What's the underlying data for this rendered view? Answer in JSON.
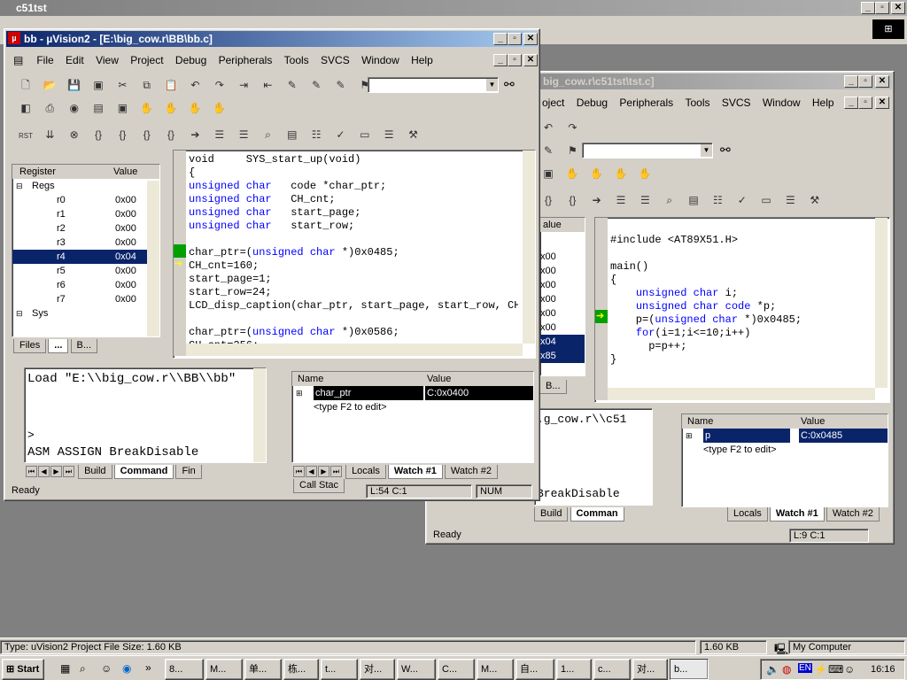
{
  "desktop_window": {
    "title": "c51tst",
    "menu_hint": "File  Edit  View  Project  Debug  Peripherals  Tools  SVCS  Window  Help"
  },
  "main_window": {
    "title": "bb - µVision2 - [E:\\big_cow.r\\BB\\bb.c]",
    "menu": [
      "File",
      "Edit",
      "View",
      "Project",
      "Debug",
      "Peripherals",
      "Tools",
      "SVCS",
      "Window",
      "Help"
    ],
    "find_box_value": "",
    "register_panel": {
      "headers": [
        "Register",
        "Value"
      ],
      "groups": [
        {
          "name": "Regs",
          "rows": [
            {
              "name": "r0",
              "value": "0x00"
            },
            {
              "name": "r1",
              "value": "0x00"
            },
            {
              "name": "r2",
              "value": "0x00"
            },
            {
              "name": "r3",
              "value": "0x00"
            },
            {
              "name": "r4",
              "value": "0x04"
            },
            {
              "name": "r5",
              "value": "0x00"
            },
            {
              "name": "r6",
              "value": "0x00"
            },
            {
              "name": "r7",
              "value": "0x00"
            }
          ]
        },
        {
          "name": "Sys",
          "rows": []
        }
      ],
      "tabs": [
        "Files",
        "...",
        "B..."
      ]
    },
    "code_lines": [
      [
        {
          "t": "void     SYS_start_up(void)",
          "k": false
        }
      ],
      [
        {
          "t": "{",
          "k": false
        }
      ],
      [
        {
          "t": "unsigned char",
          "k": true
        },
        {
          "t": "   code *char_ptr;",
          "k": false
        }
      ],
      [
        {
          "t": "unsigned char",
          "k": true
        },
        {
          "t": "   CH_cnt;",
          "k": false
        }
      ],
      [
        {
          "t": "unsigned char",
          "k": true
        },
        {
          "t": "   start_page;",
          "k": false
        }
      ],
      [
        {
          "t": "unsigned char",
          "k": true
        },
        {
          "t": "   start_row;",
          "k": false
        }
      ],
      [
        {
          "t": "",
          "k": false
        }
      ],
      [
        {
          "t": "char_ptr=(",
          "k": false
        },
        {
          "t": "unsigned char",
          "k": true
        },
        {
          "t": " *)0x0485;",
          "k": false
        }
      ],
      [
        {
          "t": "CH_cnt=160;",
          "k": false
        }
      ],
      [
        {
          "t": "start_page=1;",
          "k": false
        }
      ],
      [
        {
          "t": "start_row=24;",
          "k": false
        }
      ],
      [
        {
          "t": "LCD_disp_caption(char_ptr, start_page, start_row, CH_c",
          "k": false
        }
      ],
      [
        {
          "t": "",
          "k": false
        }
      ],
      [
        {
          "t": "char_ptr=(",
          "k": false
        },
        {
          "t": "unsigned char",
          "k": true
        },
        {
          "t": " *)0x0586;",
          "k": false
        }
      ],
      [
        {
          "t": "CH_cnt=256;",
          "k": false
        }
      ]
    ],
    "output": {
      "line1": "Load \"E:\\\\big_cow.r\\\\BB\\\\bb\"",
      "prompt": ">",
      "line2": "ASM ASSIGN BreakDisable",
      "tabs": [
        "Build",
        "Command",
        "Fin"
      ]
    },
    "watch": {
      "headers": [
        "Name",
        "Value"
      ],
      "rows": [
        {
          "name": "char_ptr",
          "value": "C:0x0400"
        },
        {
          "name": "<type F2 to edit>",
          "value": ""
        }
      ],
      "tabs": [
        "Locals",
        "Watch #1",
        "Watch #2",
        "Call Stac"
      ]
    },
    "status": {
      "left": "Ready",
      "pos": "L:54 C:1",
      "num": "NUM"
    }
  },
  "second_window": {
    "title": "big_cow.r\\c51tst\\tst.c]",
    "menu": [
      "oject",
      "Debug",
      "Peripherals",
      "Tools",
      "SVCS",
      "Window",
      "Help"
    ],
    "reg_fragment": {
      "header": "alue",
      "values": [
        "x00",
        "x00",
        "x00",
        "x00",
        "x00",
        "x00",
        "x04",
        "x85"
      ],
      "tabs": [
        "B..."
      ]
    },
    "code_lines": [
      [
        {
          "t": "",
          "k": false
        }
      ],
      [
        {
          "t": "#include <AT89X51.H>",
          "k": false
        }
      ],
      [
        {
          "t": "",
          "k": false
        }
      ],
      [
        {
          "t": "main()",
          "k": false
        }
      ],
      [
        {
          "t": "{",
          "k": false
        }
      ],
      [
        {
          "t": "    ",
          "k": false
        },
        {
          "t": "unsigned char",
          "k": true
        },
        {
          "t": " i;",
          "k": false
        }
      ],
      [
        {
          "t": "    ",
          "k": false
        },
        {
          "t": "unsigned char code",
          "k": true
        },
        {
          "t": " *p;",
          "k": false
        }
      ],
      [
        {
          "t": "    p=(",
          "k": false
        },
        {
          "t": "unsigned char",
          "k": true
        },
        {
          "t": " *)0x0485;",
          "k": false
        }
      ],
      [
        {
          "t": "    ",
          "k": false
        },
        {
          "t": "for",
          "k": true
        },
        {
          "t": "(i=1;i<=10;i++)",
          "k": false
        }
      ],
      [
        {
          "t": "      p=p++;",
          "k": false
        }
      ],
      [
        {
          "t": "}",
          "k": false
        }
      ]
    ],
    "output": {
      "line1": ".g_cow.r\\\\c51",
      "line2": "BreakDisable",
      "tabs": [
        "Build",
        "Comman"
      ]
    },
    "watch": {
      "headers": [
        "Name",
        "Value"
      ],
      "rows": [
        {
          "name": "p",
          "value": "C:0x0485"
        },
        {
          "name": "<type F2 to edit>",
          "value": ""
        }
      ],
      "tabs": [
        "Locals",
        "Watch #1",
        "Watch #2"
      ]
    },
    "status": {
      "left": "Ready",
      "pos": "L:9 C:1"
    }
  },
  "explorer_status": {
    "type": "Type: uVision2 Project File Size: 1.60 KB",
    "size": "1.60 KB",
    "location": "My Computer"
  },
  "taskbar": {
    "start": "Start",
    "buttons": [
      "8...",
      "M...",
      "单...",
      "栋...",
      "t...",
      "对...",
      "W...",
      "C...",
      "M...",
      "自...",
      "1...",
      "c...",
      "对...",
      "b..."
    ],
    "tray_lang": "EN",
    "clock": "16:16"
  }
}
